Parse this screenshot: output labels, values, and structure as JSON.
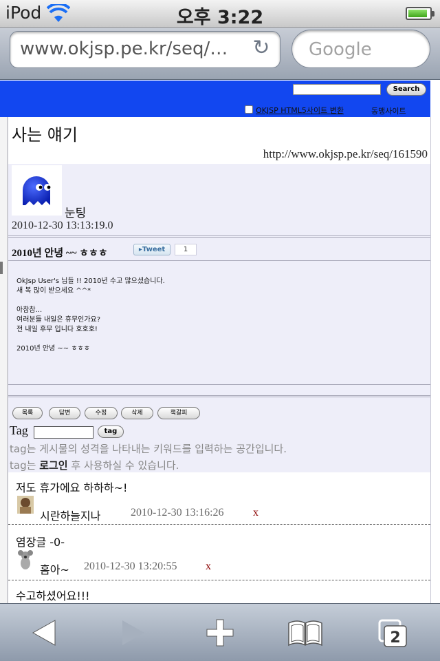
{
  "status_bar": {
    "carrier": "iPod",
    "time": "오후 3:22",
    "battery_level": 0.9
  },
  "browser": {
    "url": "www.okjsp.pe.kr/seq/…",
    "search_placeholder": "Google",
    "tab_count": "2"
  },
  "site_header": {
    "search_button": "Search",
    "html5_link": "OKJSP  HTML5사이트 변환",
    "sister_sites": "동맹사이트"
  },
  "post": {
    "title": "사는 얘기",
    "url": "http://www.okjsp.pe.kr/seq/161590",
    "author": "눈팅",
    "date": "2010-12-30 13:13:19.0",
    "heading": "2010년 안녕 ~~ ㅎㅎㅎ",
    "tweet_label": "Tweet",
    "tweet_count": "1",
    "body": "OkJsp User's 님들 !! 2010년 수고 많으셨습니다.\n새 복 많이 받으세요 ^^*\n\n아참참...\n여러분들 내일은 휴무인가요?\n전 내일 후무 입니다 호호호!\n\n2010년 안녕 ~~ ㅎㅎㅎ"
  },
  "actions": [
    "목록",
    "답변",
    "수정",
    "삭제",
    "책갈피"
  ],
  "tag_section": {
    "label": "Tag",
    "button": "tag",
    "note1_prefix": "tag",
    "note1_rest": "는 게시물의 성격을 나타내는 키워드를 입력하는 공간입니다.",
    "note2_prefix": "tag",
    "note2_mid": "는 ",
    "note2_login": "로그인",
    "note2_rest": " 후 사용하실 수 있습니다."
  },
  "comments": [
    {
      "text": "저도 휴가에요 하하하~!",
      "author": "시란하늘지나",
      "date": "2010-12-30 13:16:26",
      "delete": "x"
    },
    {
      "text": "염장글 -0-",
      "author": "홈아~",
      "date": "2010-12-30 13:20:55",
      "delete": "x"
    },
    {
      "text": "수고하셨어요!!!"
    }
  ],
  "colors": {
    "header_blue": "#1247f0",
    "panel_bg": "#eeeef9",
    "delete_red": "#8b0000"
  }
}
